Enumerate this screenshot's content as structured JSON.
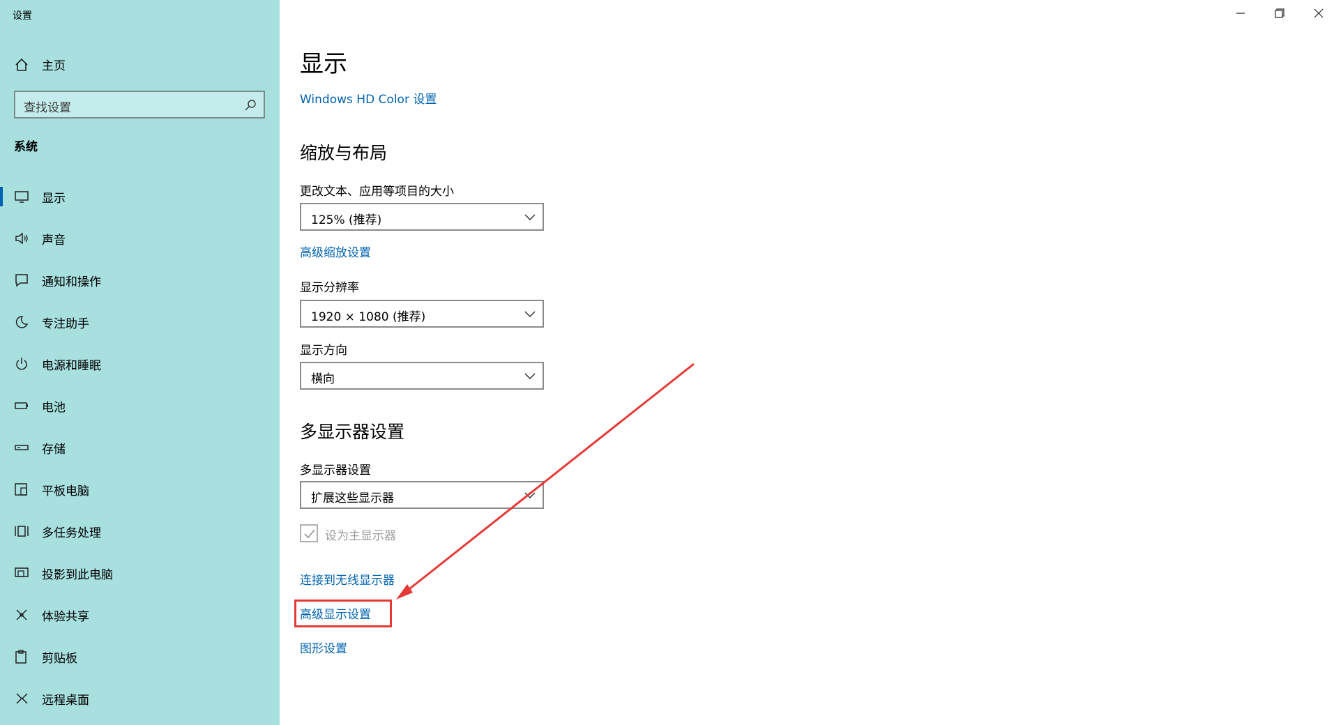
{
  "window": {
    "title": "设置",
    "controls": [
      "minimize-icon",
      "restore-icon",
      "close-icon"
    ]
  },
  "sidebar": {
    "home_label": "主页",
    "search_placeholder": "查找设置",
    "section_label": "系统",
    "items": [
      {
        "label": "显示",
        "icon": "monitor-icon",
        "active": true
      },
      {
        "label": "声音",
        "icon": "speaker-icon"
      },
      {
        "label": "通知和操作",
        "icon": "notification-icon"
      },
      {
        "label": "专注助手",
        "icon": "moon-icon"
      },
      {
        "label": "电源和睡眠",
        "icon": "power-icon"
      },
      {
        "label": "电池",
        "icon": "battery-icon"
      },
      {
        "label": "存储",
        "icon": "storage-icon"
      },
      {
        "label": "平板电脑",
        "icon": "tablet-icon"
      },
      {
        "label": "多任务处理",
        "icon": "multitask-icon"
      },
      {
        "label": "投影到此电脑",
        "icon": "project-icon"
      },
      {
        "label": "体验共享",
        "icon": "share-icon"
      },
      {
        "label": "剪贴板",
        "icon": "clipboard-icon"
      },
      {
        "label": "远程桌面",
        "icon": "remote-desktop-icon"
      }
    ]
  },
  "main": {
    "title": "显示",
    "hd_color_link": "Windows HD Color 设置",
    "scale_section": {
      "heading": "缩放与布局",
      "scale_label": "更改文本、应用等项目的大小",
      "scale_value": "125% (推荐)",
      "advanced_scale_link": "高级缩放设置",
      "resolution_label": "显示分辨率",
      "resolution_value": "1920 × 1080 (推荐)",
      "orientation_label": "显示方向",
      "orientation_value": "横向"
    },
    "multi_section": {
      "heading": "多显示器设置",
      "multi_label": "多显示器设置",
      "multi_value": "扩展这些显示器",
      "primary_checkbox_label": "设为主显示器",
      "primary_checked": true,
      "wireless_link": "连接到无线显示器",
      "advanced_display_link": "高级显示设置",
      "graphics_link": "图形设置"
    }
  },
  "colors": {
    "sidebar_bg": "#a8dfdf",
    "accent": "#0063b1",
    "annotation": "#e53935"
  }
}
